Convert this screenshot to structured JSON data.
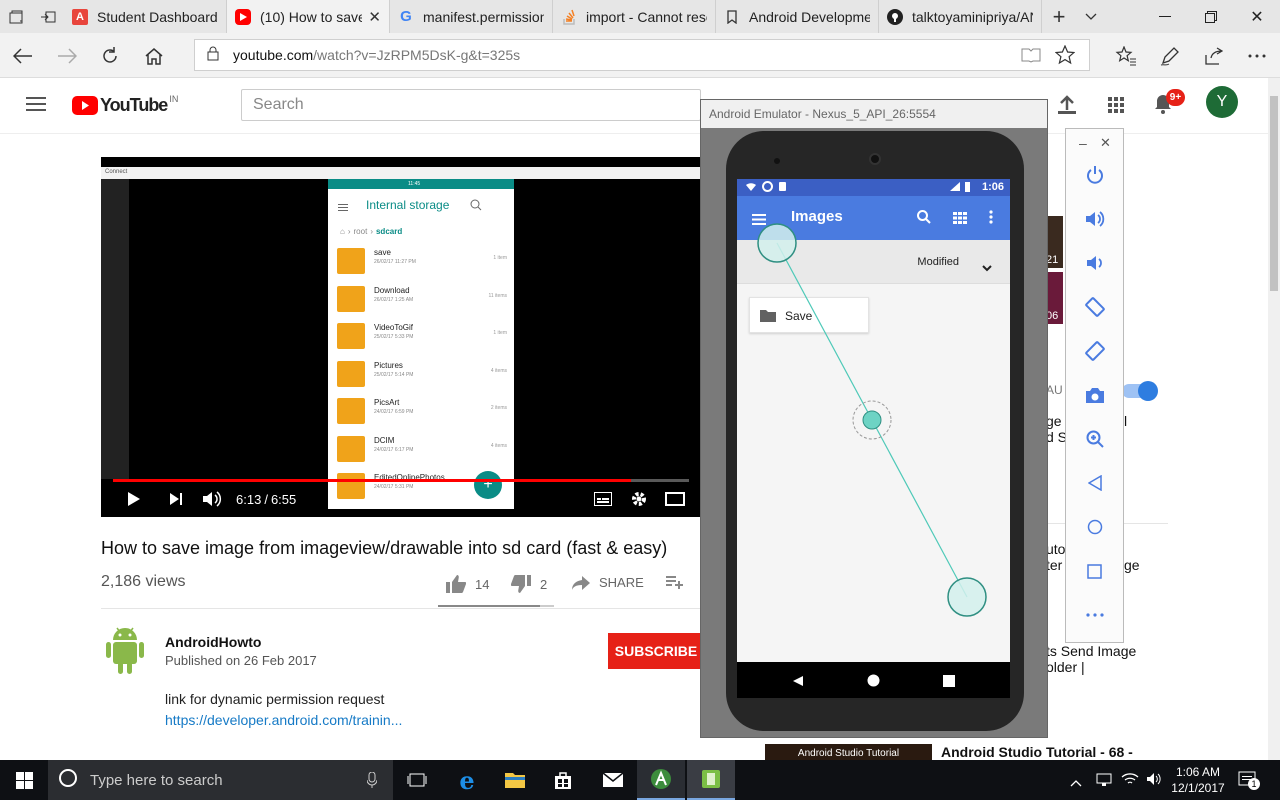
{
  "browser": {
    "tabs": [
      {
        "title": "Student Dashboard",
        "icon": "student-dashboard-favicon",
        "color": "#e8453c"
      },
      {
        "title": "(10) How to save",
        "icon": "youtube-favicon",
        "color": "#ff0000"
      },
      {
        "title": "manifest.permission.",
        "icon": "google-favicon",
        "color": "#4285f4"
      },
      {
        "title": "import - Cannot reso",
        "icon": "stackoverflow-favicon",
        "color": "#f48024"
      },
      {
        "title": "Android Developmer",
        "icon": "bookmark-favicon",
        "color": "#333333"
      },
      {
        "title": "talktoyaminipriya/AN",
        "icon": "github-favicon",
        "color": "#222222"
      }
    ],
    "address": {
      "host": "youtube.com",
      "path": "/watch?v=JzRPM5DsK-g&t=325s"
    }
  },
  "youtube": {
    "logo_text": "YouTube",
    "region": "IN",
    "search_placeholder": "Search",
    "notification_count": "9+",
    "avatar_letter": "Y"
  },
  "video": {
    "time_current": "6:13",
    "time_sep": "/",
    "time_total": "6:55",
    "progress": 0.9,
    "inner_app": {
      "clock": "11:45",
      "title": "Internal storage",
      "breadcrumb_root": "root",
      "breadcrumb_current": "sdcard",
      "window_label": "Connect",
      "folders": [
        {
          "name": "save",
          "date": "26/02/17 11:27 PM",
          "count": "1 item"
        },
        {
          "name": "Download",
          "date": "26/02/17 1:25 AM",
          "count": "11 items"
        },
        {
          "name": "VideoToGif",
          "date": "25/02/17 5:33 PM",
          "count": "1 item"
        },
        {
          "name": "Pictures",
          "date": "25/02/17 5:14 PM",
          "count": "4 items"
        },
        {
          "name": "PicsArt",
          "date": "24/02/17 6:59 PM",
          "count": "2 items"
        },
        {
          "name": "DCIM",
          "date": "24/02/17 6:17 PM",
          "count": "4 items"
        },
        {
          "name": "EditedOnlinePhotos",
          "date": "24/02/17 5:31 PM",
          "count": ""
        }
      ]
    }
  },
  "details": {
    "title": "How to save image from imageview/drawable into sd card (fast & easy)",
    "views": "2,186 views",
    "likes": "14",
    "dislikes": "2",
    "share_label": "SHARE",
    "like_ratio": 0.875,
    "channel": "AndroidHowto",
    "published": "Published on 26 Feb 2017",
    "subscribe_label": "SUBSCRIBE",
    "description_line": "link for dynamic permission request",
    "description_link": "https://developer.android.com/trainin..."
  },
  "sidebar_fragments": {
    "thumb1_time": "21",
    "thumb2_time": "06",
    "autoplay_label": "AU",
    "frag_a1": "ge",
    "frag_a2": "l",
    "frag_b1": "d S",
    "frag_c1": "uto",
    "frag_c2": "ter",
    "frag_c3": "ge",
    "frag_d1": "ts Send Image",
    "frag_d2": "older |",
    "bottom_thumb_label": "Android Studio Tutorial",
    "bottom_title": "Android Studio Tutorial - 68 -"
  },
  "emulator": {
    "window_title": "Android Emulator - Nexus_5_API_26:5554",
    "status_time": "1:06",
    "app_title": "Images",
    "sort_label": "Modified",
    "folder_name": "Save",
    "accent": "#4a7be0"
  },
  "taskbar": {
    "search_placeholder": "Type here to search",
    "time": "1:06 AM",
    "date": "12/1/2017",
    "notification_count": "1"
  }
}
